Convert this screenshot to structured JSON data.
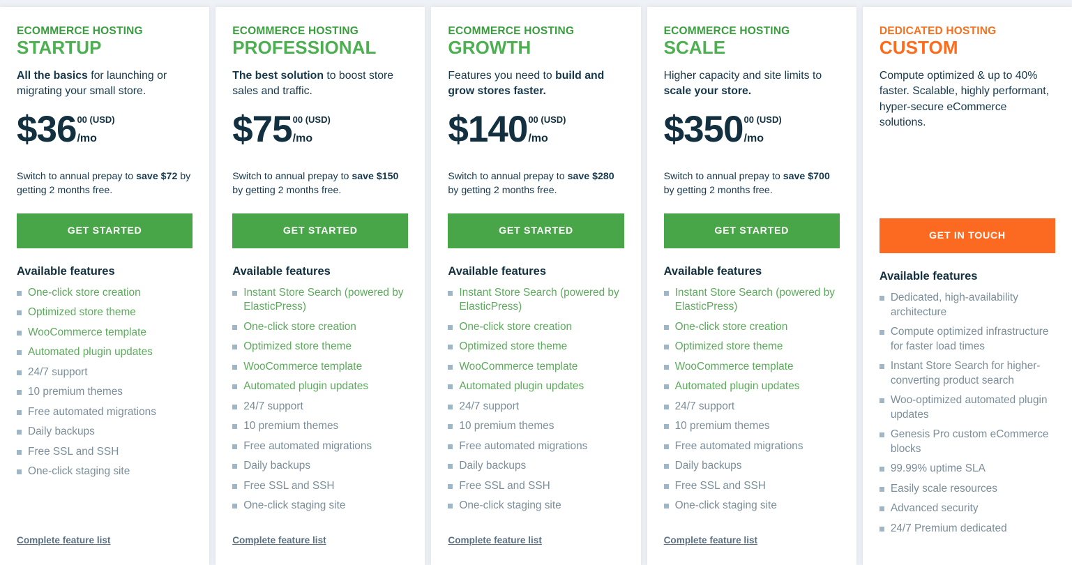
{
  "colors": {
    "page_background": "#eef1f5",
    "card_background": "#ffffff",
    "green_eyebrow": "#3a9e3f",
    "green_plan_name": "#4caf50",
    "green_button": "#48a548",
    "green_feature": "#5cab5c",
    "orange_eyebrow": "#f4711f",
    "orange_plan_name": "#ff6b1a",
    "orange_button": "#fc6a21",
    "text_dark": "#12303f",
    "text_body": "#17394d",
    "text_muted": "#7b8e99",
    "bullet": "#9fb6c6",
    "link": "#5a7183"
  },
  "common": {
    "features_title": "Available features",
    "complete_feature_list_link": "Complete feature list",
    "price_cents_suffix": "00 (USD)",
    "price_period": "/mo"
  },
  "plans": [
    {
      "eyebrow": "ECOMMERCE HOSTING",
      "name": "STARTUP",
      "accent": "green",
      "tagline_bold_lead": "All the basics",
      "tagline_rest": " for launching or migrating your small store.",
      "has_price": true,
      "price_amount": "$36",
      "price_cents": "00 (USD)",
      "price_period": "/mo",
      "note_prefix": "Switch to annual prepay to ",
      "note_bold_1": "save",
      "note_middle": " ",
      "note_bold_2": "$72",
      "note_suffix": " by getting 2 months free.",
      "cta_label": "GET STARTED",
      "features_title": "Available features",
      "features": [
        {
          "label": "One-click store creation",
          "highlighted": true
        },
        {
          "label": "Optimized store theme",
          "highlighted": true
        },
        {
          "label": "WooCommerce template",
          "highlighted": true
        },
        {
          "label": "Automated plugin updates",
          "highlighted": true
        },
        {
          "label": "24/7 support",
          "highlighted": false
        },
        {
          "label": "10 premium themes",
          "highlighted": false
        },
        {
          "label": "Free automated migrations",
          "highlighted": false
        },
        {
          "label": "Daily backups",
          "highlighted": false
        },
        {
          "label": "Free SSL and SSH",
          "highlighted": false
        },
        {
          "label": "One-click staging site",
          "highlighted": false
        }
      ],
      "footer_link": "Complete feature list"
    },
    {
      "eyebrow": "ECOMMERCE HOSTING",
      "name": "PROFESSIONAL",
      "accent": "green",
      "tagline_bold_lead": "The best solution",
      "tagline_rest": " to boost store sales and traffic.",
      "has_price": true,
      "price_amount": "$75",
      "price_cents": "00 (USD)",
      "price_period": "/mo",
      "note_prefix": "Switch to annual prepay to ",
      "note_bold_1": "save",
      "note_middle": " ",
      "note_bold_2": "$150",
      "note_suffix": " by getting 2 months free.",
      "cta_label": "GET STARTED",
      "features_title": "Available features",
      "features": [
        {
          "label": "Instant Store Search (powered by ElasticPress)",
          "highlighted": true
        },
        {
          "label": "One-click store creation",
          "highlighted": true
        },
        {
          "label": "Optimized store theme",
          "highlighted": true
        },
        {
          "label": "WooCommerce template",
          "highlighted": true
        },
        {
          "label": "Automated plugin updates",
          "highlighted": true
        },
        {
          "label": "24/7 support",
          "highlighted": false
        },
        {
          "label": "10 premium themes",
          "highlighted": false
        },
        {
          "label": "Free automated migrations",
          "highlighted": false
        },
        {
          "label": "Daily backups",
          "highlighted": false
        },
        {
          "label": "Free SSL and SSH",
          "highlighted": false
        },
        {
          "label": "One-click staging site",
          "highlighted": false
        }
      ],
      "footer_link": "Complete feature list"
    },
    {
      "eyebrow": "ECOMMERCE HOSTING",
      "name": "GROWTH",
      "accent": "green",
      "tagline_bold_lead": "",
      "tagline_rest": "Features you need to ",
      "tagline_bold_tail": "build and grow stores faster.",
      "has_price": true,
      "price_amount": "$140",
      "price_cents": "00 (USD)",
      "price_period": "/mo",
      "note_prefix": "Switch to annual prepay to ",
      "note_bold_1": "save",
      "note_middle": " ",
      "note_bold_2": "$280",
      "note_suffix": " by getting 2 months free.",
      "cta_label": "GET STARTED",
      "features_title": "Available features",
      "features": [
        {
          "label": "Instant Store Search (powered by ElasticPress)",
          "highlighted": true
        },
        {
          "label": "One-click store creation",
          "highlighted": true
        },
        {
          "label": "Optimized store theme",
          "highlighted": true
        },
        {
          "label": "WooCommerce template",
          "highlighted": true
        },
        {
          "label": "Automated plugin updates",
          "highlighted": true
        },
        {
          "label": "24/7 support",
          "highlighted": false
        },
        {
          "label": "10 premium themes",
          "highlighted": false
        },
        {
          "label": "Free automated migrations",
          "highlighted": false
        },
        {
          "label": "Daily backups",
          "highlighted": false
        },
        {
          "label": "Free SSL and SSH",
          "highlighted": false
        },
        {
          "label": "One-click staging site",
          "highlighted": false
        }
      ],
      "footer_link": "Complete feature list"
    },
    {
      "eyebrow": "ECOMMERCE HOSTING",
      "name": "SCALE",
      "accent": "green",
      "tagline_bold_lead": "",
      "tagline_rest": "Higher capacity and site limits to ",
      "tagline_bold_tail": "scale your store.",
      "has_price": true,
      "price_amount": "$350",
      "price_cents": "00 (USD)",
      "price_period": "/mo",
      "note_prefix": "Switch to annual prepay to ",
      "note_bold_1": "save",
      "note_middle": " ",
      "note_bold_2": "$700",
      "note_suffix": " by getting 2 months free.",
      "cta_label": "GET STARTED",
      "features_title": "Available features",
      "features": [
        {
          "label": "Instant Store Search (powered by ElasticPress)",
          "highlighted": true
        },
        {
          "label": "One-click store creation",
          "highlighted": true
        },
        {
          "label": "Optimized store theme",
          "highlighted": true
        },
        {
          "label": "WooCommerce template",
          "highlighted": true
        },
        {
          "label": "Automated plugin updates",
          "highlighted": true
        },
        {
          "label": "24/7 support",
          "highlighted": false
        },
        {
          "label": "10 premium themes",
          "highlighted": false
        },
        {
          "label": "Free automated migrations",
          "highlighted": false
        },
        {
          "label": "Daily backups",
          "highlighted": false
        },
        {
          "label": "Free SSL and SSH",
          "highlighted": false
        },
        {
          "label": "One-click staging site",
          "highlighted": false
        }
      ],
      "footer_link": "Complete feature list"
    },
    {
      "eyebrow": "DEDICATED HOSTING",
      "name": "CUSTOM",
      "accent": "orange",
      "tagline_bold_lead": "",
      "tagline_rest": "Compute optimized & up to 40% faster. Scalable, highly performant, hyper-secure eCommerce solutions.",
      "has_price": false,
      "price_amount": "",
      "price_cents": "",
      "price_period": "",
      "note_prefix": "",
      "note_bold_1": "",
      "note_middle": "",
      "note_bold_2": "",
      "note_suffix": "",
      "cta_label": "GET IN TOUCH",
      "features_title": "Available features",
      "features": [
        {
          "label": "Dedicated, high-availability architecture",
          "highlighted": false
        },
        {
          "label": "Compute optimized infrastructure for faster load times",
          "highlighted": false
        },
        {
          "label": "Instant Store Search for higher-converting product search",
          "highlighted": false
        },
        {
          "label": "Woo-optimized automated plugin updates",
          "highlighted": false
        },
        {
          "label": "Genesis Pro custom eCommerce blocks",
          "highlighted": false
        },
        {
          "label": "99.99% uptime SLA",
          "highlighted": false
        },
        {
          "label": "Easily scale resources",
          "highlighted": false
        },
        {
          "label": "Advanced security",
          "highlighted": false
        },
        {
          "label": "24/7 Premium dedicated",
          "highlighted": false
        }
      ],
      "footer_link": ""
    }
  ]
}
